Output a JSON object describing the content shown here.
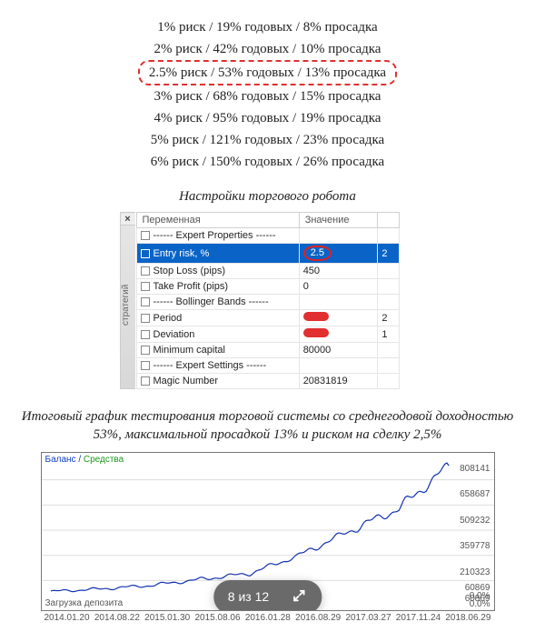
{
  "risk_lines": [
    {
      "text": "1% риск / 19% годовых / 8% просадка",
      "hl": false
    },
    {
      "text": "2% риск / 42% годовых / 10% просадка",
      "hl": false
    },
    {
      "text": "2.5% риск / 53% годовых / 13% просадка",
      "hl": true
    },
    {
      "text": "3% риск / 68% годовых / 15% просадка",
      "hl": false
    },
    {
      "text": "4% риск / 95% годовых / 19% просадка",
      "hl": false
    },
    {
      "text": "5% риск / 121% годовых / 23% просадка",
      "hl": false
    },
    {
      "text": "6% риск / 150% годовых / 26% просадка",
      "hl": false
    }
  ],
  "settings_title": "Настройки торгового робота",
  "side": {
    "close": "×",
    "label": "стратегий"
  },
  "table": {
    "headers": [
      "Переменная",
      "Значение",
      ""
    ],
    "rows": [
      {
        "name": "------ Expert Properties ------",
        "value": "",
        "selected": false,
        "redact": false,
        "circle": false,
        "extra": ""
      },
      {
        "name": "Entry risk, %",
        "value": "2.5",
        "selected": true,
        "redact": false,
        "circle": true,
        "extra": "2"
      },
      {
        "name": "Stop Loss (pips)",
        "value": "450",
        "selected": false,
        "redact": false,
        "circle": false,
        "extra": ""
      },
      {
        "name": "Take Profit (pips)",
        "value": "0",
        "selected": false,
        "redact": false,
        "circle": false,
        "extra": ""
      },
      {
        "name": "------ Bollinger Bands ------",
        "value": "",
        "selected": false,
        "redact": false,
        "circle": false,
        "extra": ""
      },
      {
        "name": "Period",
        "value": "",
        "selected": false,
        "redact": true,
        "circle": false,
        "extra": "2"
      },
      {
        "name": "Deviation",
        "value": "",
        "selected": false,
        "redact": true,
        "circle": false,
        "extra": "1"
      },
      {
        "name": "Minimum capital",
        "value": "80000",
        "selected": false,
        "redact": false,
        "circle": false,
        "extra": ""
      },
      {
        "name": "------ Expert Settings ------",
        "value": "",
        "selected": false,
        "redact": false,
        "circle": false,
        "extra": ""
      },
      {
        "name": "Magic Number",
        "value": "20831819",
        "selected": false,
        "redact": false,
        "circle": false,
        "extra": ""
      }
    ]
  },
  "final_caption": "Итоговый график тестирования торговой системы со среднегодовой доходностью 53%, максимальной просадкой 13% и риском на сделку 2,5%",
  "chart": {
    "legend_balance": "Баланс",
    "legend_equity": "Средства",
    "footer": "Загрузка депозита",
    "pct_top": "0.0%",
    "pct_bot": "0.0%",
    "pct_side": "60869"
  },
  "overlay": {
    "counter": "8 из 12"
  },
  "chart_data": {
    "type": "line",
    "title": "",
    "xlabel": "",
    "ylabel": "",
    "x": [
      "2014.01.20",
      "2014.08.22",
      "2015.01.30",
      "2015.08.06",
      "2016.01.28",
      "2016.08.29",
      "2017.03.27",
      "2017.11.24",
      "2018.06.29"
    ],
    "y_ticks": [
      808141,
      658687,
      509232,
      359778,
      210323,
      60869
    ],
    "ylim": [
      50000,
      820000
    ],
    "series": [
      {
        "name": "Баланс",
        "color": "#1030b0",
        "values": [
          80000,
          95000,
          115000,
          150000,
          185000,
          290000,
          430000,
          560000,
          808141
        ]
      }
    ]
  }
}
